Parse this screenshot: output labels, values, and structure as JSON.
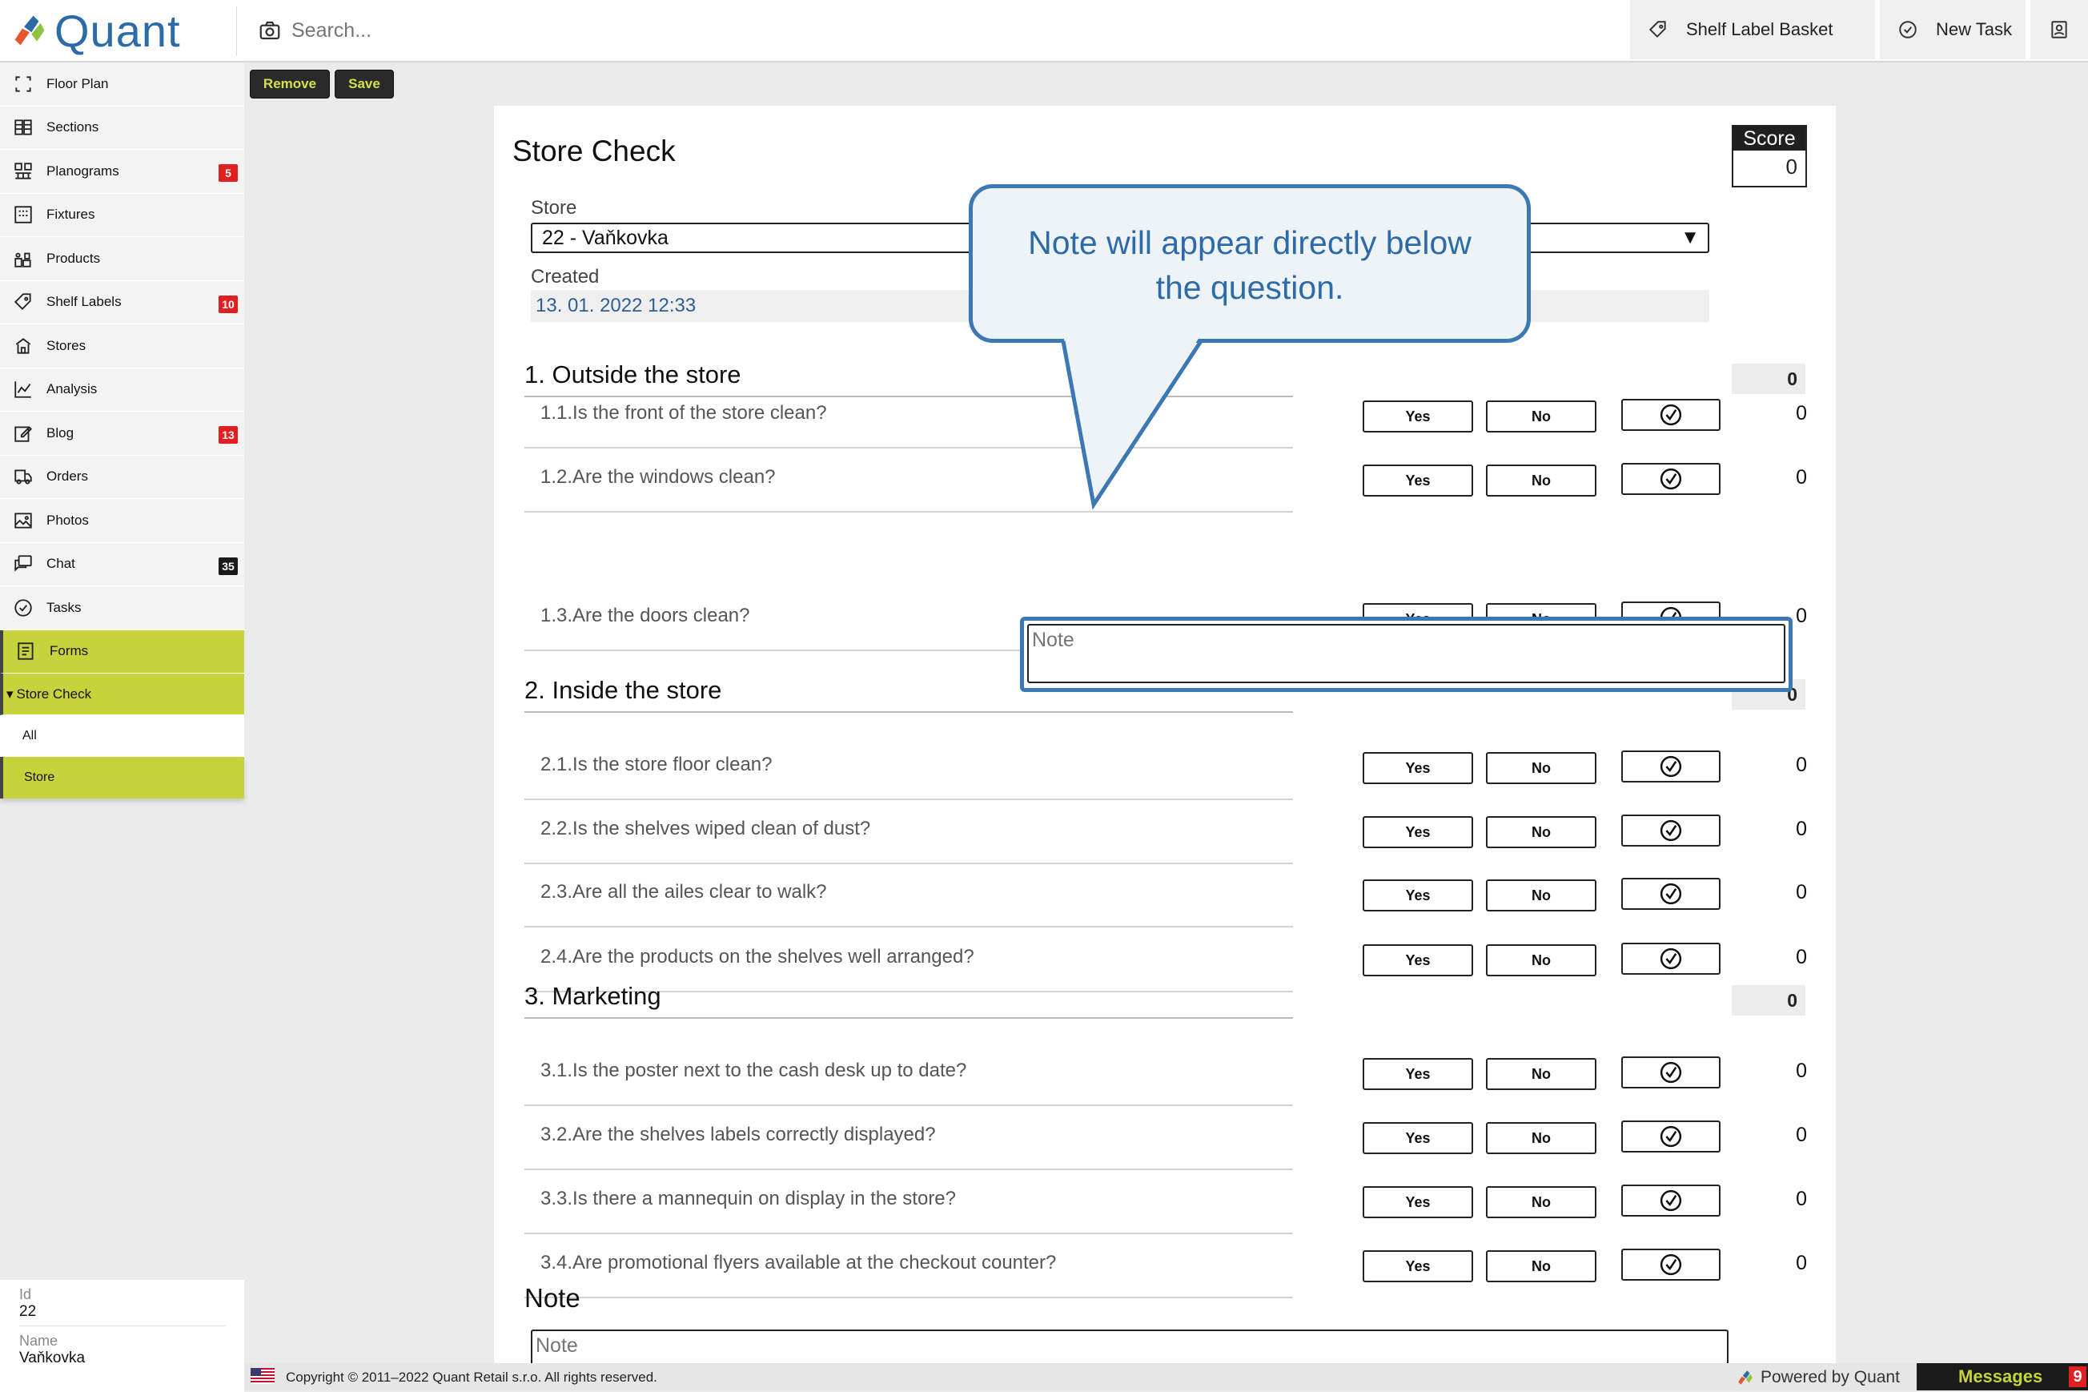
{
  "app": {
    "name": "Quant"
  },
  "header": {
    "search_placeholder": "Search...",
    "shelf_label_basket": "Shelf Label Basket",
    "new_task": "New Task"
  },
  "sidebar": {
    "items": [
      {
        "label": "Floor Plan",
        "icon": "floor-plan-icon",
        "badge": ""
      },
      {
        "label": "Sections",
        "icon": "sections-icon",
        "badge": ""
      },
      {
        "label": "Planograms",
        "icon": "planograms-icon",
        "badge": "5"
      },
      {
        "label": "Fixtures",
        "icon": "fixtures-icon",
        "badge": ""
      },
      {
        "label": "Products",
        "icon": "products-icon",
        "badge": ""
      },
      {
        "label": "Shelf Labels",
        "icon": "tag-icon",
        "badge": "10"
      },
      {
        "label": "Stores",
        "icon": "store-icon",
        "badge": ""
      },
      {
        "label": "Analysis",
        "icon": "chart-icon",
        "badge": ""
      },
      {
        "label": "Blog",
        "icon": "edit-icon",
        "badge": "13"
      },
      {
        "label": "Orders",
        "icon": "truck-icon",
        "badge": ""
      },
      {
        "label": "Photos",
        "icon": "image-icon",
        "badge": ""
      },
      {
        "label": "Chat",
        "icon": "chat-icon",
        "badge": "35"
      },
      {
        "label": "Tasks",
        "icon": "check-circle-icon",
        "badge": ""
      },
      {
        "label": "Forms",
        "icon": "form-icon",
        "badge": ""
      }
    ],
    "group": "Store Check",
    "sub": [
      "All",
      "Store"
    ],
    "info": {
      "id_label": "Id",
      "id_value": "22",
      "name_label": "Name",
      "name_value": "Vaňkovka"
    }
  },
  "toolbar": {
    "remove": "Remove",
    "save": "Save"
  },
  "form": {
    "title": "Store Check",
    "score_label": "Score",
    "score_value": "0",
    "store_label": "Store",
    "store_value": "22 - Vaňkovka",
    "store_arrow": "▼",
    "created_label": "Created",
    "created_value": "13. 01. 2022 12:33",
    "yes": "Yes",
    "no": "No",
    "sections": [
      {
        "title": "1. Outside the store",
        "score": "0",
        "questions": [
          {
            "text": "1.1.Is the front of the store clean?",
            "score": "0"
          },
          {
            "text": "1.2.Are the windows clean?",
            "score": "0"
          },
          {
            "text": "1.3.Are the doors clean?",
            "score": "0"
          }
        ]
      },
      {
        "title": "2. Inside the store",
        "score": "0",
        "questions": [
          {
            "text": "2.1.Is the store floor clean?",
            "score": "0"
          },
          {
            "text": "2.2.Is the shelves wiped clean of dust?",
            "score": "0"
          },
          {
            "text": "2.3.Are all the ailes clear to walk?",
            "score": "0"
          },
          {
            "text": "2.4.Are the products on the shelves well arranged?",
            "score": "0"
          }
        ]
      },
      {
        "title": "3. Marketing",
        "score": "0",
        "questions": [
          {
            "text": "3.1.Is the poster next to the cash desk up to date?",
            "score": "0"
          },
          {
            "text": "3.2.Are the shelves labels correctly displayed?",
            "score": "0"
          },
          {
            "text": "3.3.Is there a mannequin on display in the store?",
            "score": "0"
          },
          {
            "text": "3.4.Are promotional flyers available at the checkout counter?",
            "score": "0"
          }
        ]
      }
    ],
    "note_placeholder": "Note",
    "note_title": "Note",
    "note_bottom_placeholder": "Note"
  },
  "callout": {
    "line1": "Note will appear directly below",
    "line2": "the question."
  },
  "footer": {
    "copyright": "Copyright © 2011–2022 Quant Retail s.r.o. All rights reserved.",
    "powered": "Powered by Quant",
    "messages": "Messages",
    "messages_count": "9"
  },
  "colors": {
    "accent": "#c6d33a",
    "brand": "#2d6aa8",
    "badge": "#e02020",
    "callout_border": "#3b78b4"
  }
}
